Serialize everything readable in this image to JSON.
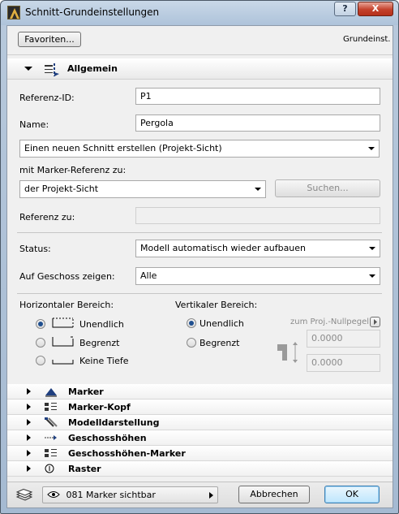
{
  "window": {
    "title": "Schnitt-Grundeinstellungen",
    "help_label": "?",
    "close_label": "X"
  },
  "toolbar": {
    "favorites_label": "Favoriten...",
    "mode_label": "Grundeinst."
  },
  "general": {
    "header": "Allgemein",
    "reference_id_label": "Referenz-ID:",
    "reference_id_value": "P1",
    "name_label": "Name:",
    "name_value": "Pergola",
    "create_mode": "Einen neuen Schnitt erstellen (Projekt-Sicht)",
    "marker_ref_label": "mit Marker-Referenz zu:",
    "marker_ref_value": "der Projekt-Sicht",
    "search_label": "Suchen...",
    "reference_to_label": "Referenz zu:",
    "reference_to_value": "",
    "status_label": "Status:",
    "status_value": "Modell automatisch wieder aufbauen",
    "show_on_story_label": "Auf Geschoss zeigen:",
    "show_on_story_value": "Alle",
    "horizontal_label": "Horizontaler Bereich:",
    "horizontal_options": [
      {
        "label": "Unendlich",
        "selected": true
      },
      {
        "label": "Begrenzt",
        "selected": false
      },
      {
        "label": "Keine Tiefe",
        "selected": false
      }
    ],
    "vertical_label": "Vertikaler Bereich:",
    "vertical_options": [
      {
        "label": "Unendlich",
        "selected": true
      },
      {
        "label": "Begrenzt",
        "selected": false
      }
    ],
    "zero_level_label": "zum Proj.-Nullpegel",
    "upper_value": "0.0000",
    "lower_value": "0.0000"
  },
  "sections": [
    {
      "label": "Marker",
      "icon": "marker-triangle-icon"
    },
    {
      "label": "Marker-Kopf",
      "icon": "marker-head-icon"
    },
    {
      "label": "Modelldarstellung",
      "icon": "model-display-icon"
    },
    {
      "label": "Geschosshöhen",
      "icon": "story-levels-icon"
    },
    {
      "label": "Geschosshöhen-Marker",
      "icon": "story-level-marker-icon"
    },
    {
      "label": "Raster",
      "icon": "grid-icon"
    }
  ],
  "footer": {
    "layer_value": "081 Marker sichtbar",
    "cancel_label": "Abbrechen",
    "ok_label": "OK"
  }
}
